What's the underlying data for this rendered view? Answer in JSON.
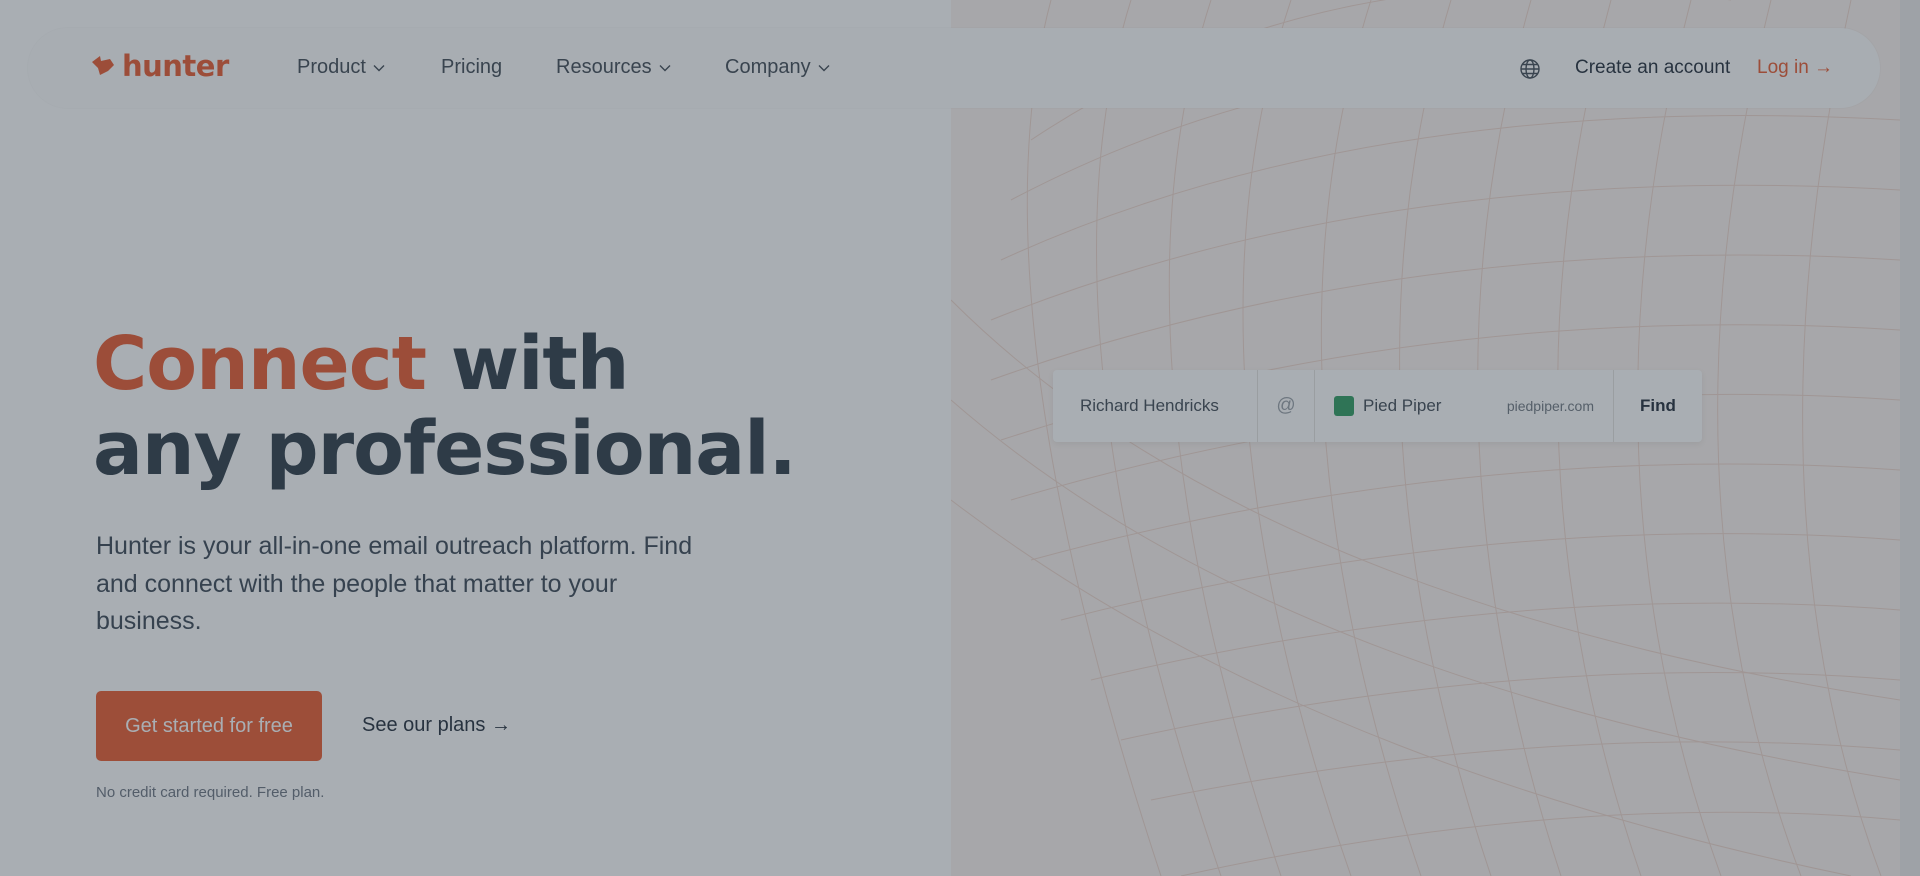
{
  "brand": {
    "name": "hunter",
    "color": "#e8582d"
  },
  "nav": {
    "items": [
      {
        "label": "Product",
        "has_dropdown": true
      },
      {
        "label": "Pricing",
        "has_dropdown": false
      },
      {
        "label": "Resources",
        "has_dropdown": true
      },
      {
        "label": "Company",
        "has_dropdown": true
      }
    ],
    "language_icon": "globe-icon",
    "create_account": "Create an account",
    "login": "Log in →"
  },
  "hero": {
    "headline_accent": "Connect",
    "headline_rest_line1": " with",
    "headline_line2": "any professional.",
    "subtext": "Hunter is your all-in-one email outreach platform. Find and connect with the people that matter to your business.",
    "cta_primary": "Get started for free",
    "cta_secondary": "See our plans →",
    "fineprint": "No credit card required. Free plan."
  },
  "finder": {
    "name_value": "Richard Hendricks",
    "at_symbol": "@",
    "company_name": "Pied Piper",
    "company_domain": "piedpiper.com",
    "find_label": "Find"
  },
  "colors": {
    "accent": "#e8582d",
    "heading": "#2b3946",
    "overlay": "rgba(50,62,75,0.42)"
  }
}
